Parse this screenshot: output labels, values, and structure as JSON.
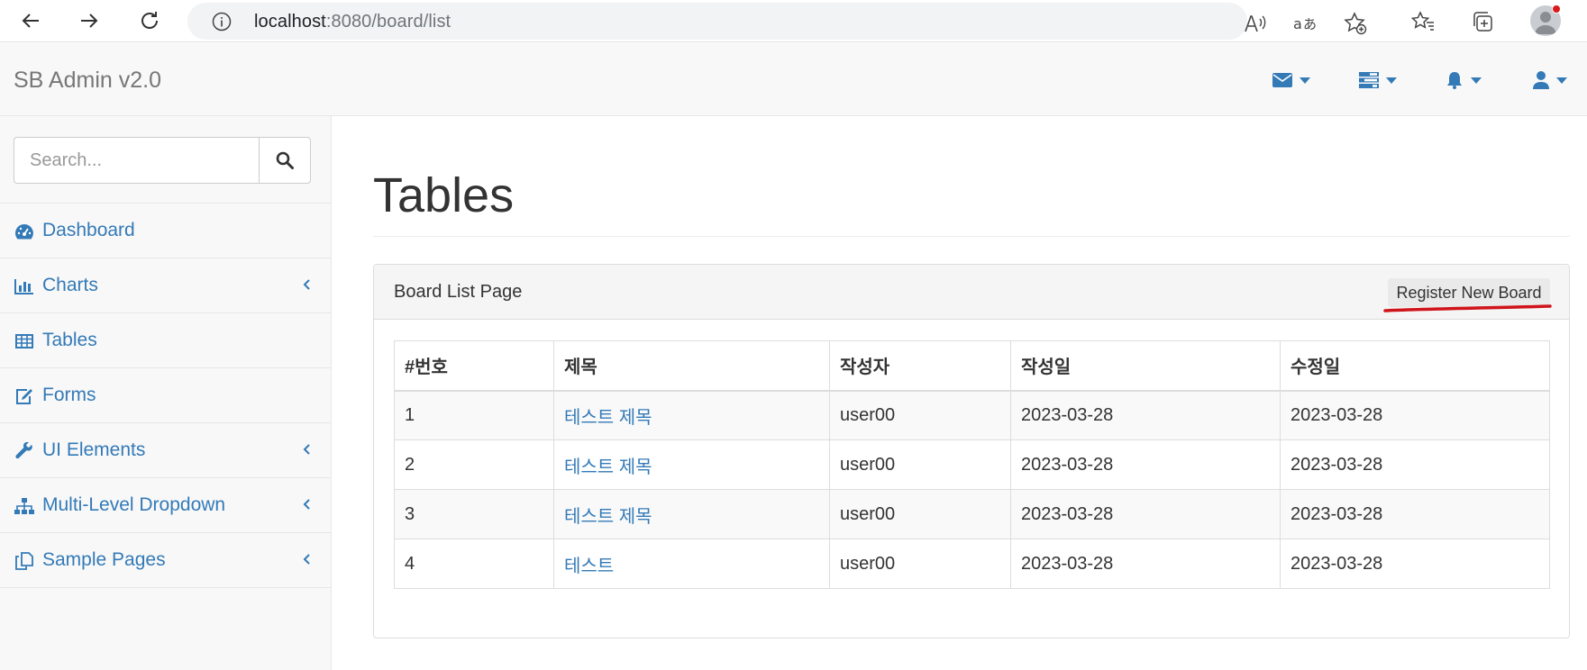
{
  "browser": {
    "url_host": "localhost",
    "url_rest": ":8080/board/list"
  },
  "navbar": {
    "brand": "SB Admin v2.0",
    "icons": [
      "envelope-icon",
      "tasks-icon",
      "bell-icon",
      "user-icon"
    ],
    "accent_color": "#337ab7"
  },
  "sidebar": {
    "search_placeholder": "Search...",
    "items": [
      {
        "label": "Dashboard",
        "icon": "dashboard-icon",
        "has_children": false
      },
      {
        "label": "Charts",
        "icon": "bar-chart-icon",
        "has_children": true
      },
      {
        "label": "Tables",
        "icon": "table-icon",
        "has_children": false
      },
      {
        "label": "Forms",
        "icon": "edit-icon",
        "has_children": false
      },
      {
        "label": "UI Elements",
        "icon": "wrench-icon",
        "has_children": true
      },
      {
        "label": "Multi-Level Dropdown",
        "icon": "sitemap-icon",
        "has_children": true
      },
      {
        "label": "Sample Pages",
        "icon": "files-icon",
        "has_children": true
      }
    ]
  },
  "main": {
    "page_title": "Tables",
    "panel_title": "Board List Page",
    "register_button": "Register New Board",
    "table": {
      "headers": [
        "#번호",
        "제목",
        "작성자",
        "작성일",
        "수정일"
      ],
      "rows": [
        {
          "no": "1",
          "title": "테스트 제목",
          "writer": "user00",
          "regdate": "2023-03-28",
          "updatedate": "2023-03-28"
        },
        {
          "no": "2",
          "title": "테스트 제목",
          "writer": "user00",
          "regdate": "2023-03-28",
          "updatedate": "2023-03-28"
        },
        {
          "no": "3",
          "title": "테스트 제목",
          "writer": "user00",
          "regdate": "2023-03-28",
          "updatedate": "2023-03-28"
        },
        {
          "no": "4",
          "title": "테스트",
          "writer": "user00",
          "regdate": "2023-03-28",
          "updatedate": "2023-03-28"
        }
      ]
    }
  }
}
